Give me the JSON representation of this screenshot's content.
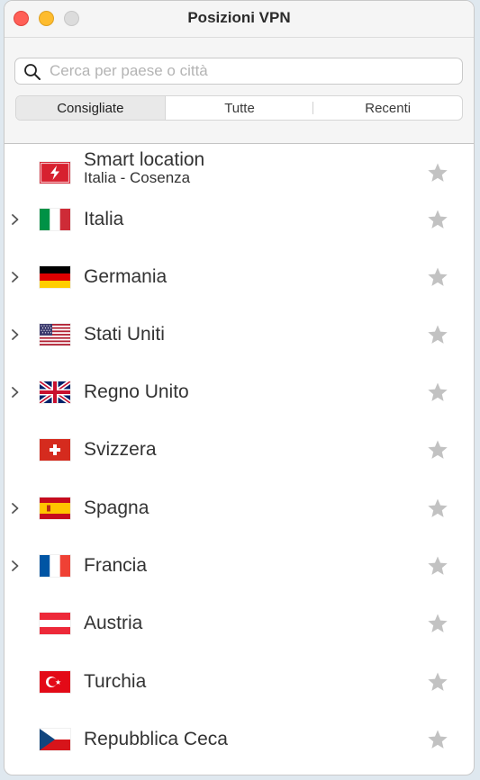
{
  "window": {
    "title": "Posizioni VPN"
  },
  "search": {
    "placeholder": "Cerca per paese o città",
    "value": ""
  },
  "tabs": [
    {
      "label": "Consigliate",
      "active": true
    },
    {
      "label": "Tutte",
      "active": false
    },
    {
      "label": "Recenti",
      "active": false
    }
  ],
  "smart_location": {
    "label": "Smart location",
    "sublabel": "Italia - Cosenza",
    "icon": "lightning-bolt-icon",
    "color": "#d7212f"
  },
  "locations": [
    {
      "name": "Italia",
      "expandable": true,
      "flag": "it"
    },
    {
      "name": "Germania",
      "expandable": true,
      "flag": "de"
    },
    {
      "name": "Stati Uniti",
      "expandable": true,
      "flag": "us"
    },
    {
      "name": "Regno Unito",
      "expandable": true,
      "flag": "gb"
    },
    {
      "name": "Svizzera",
      "expandable": false,
      "flag": "ch"
    },
    {
      "name": "Spagna",
      "expandable": true,
      "flag": "es"
    },
    {
      "name": "Francia",
      "expandable": true,
      "flag": "fr"
    },
    {
      "name": "Austria",
      "expandable": false,
      "flag": "at"
    },
    {
      "name": "Turchia",
      "expandable": false,
      "flag": "tr"
    },
    {
      "name": "Repubblica Ceca",
      "expandable": false,
      "flag": "cz"
    }
  ],
  "colors": {
    "star": "#c2c2c2",
    "text": "#333333",
    "header_bg": "#f5f5f5"
  }
}
